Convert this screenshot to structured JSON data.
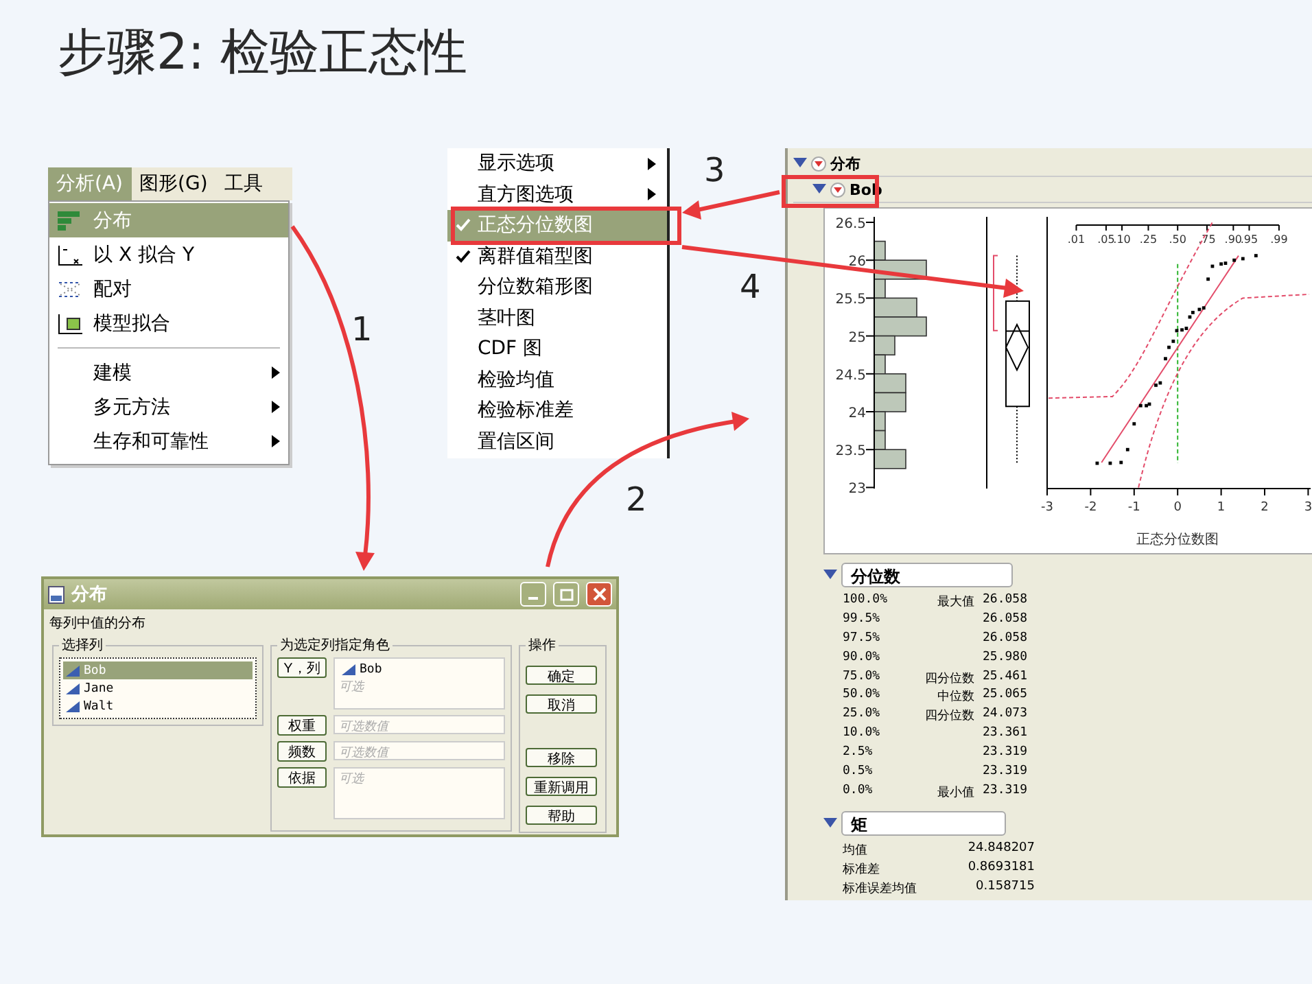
{
  "title": "步骤2: 检验正态性",
  "menu": {
    "bar": [
      {
        "label": "分析(A)",
        "selected": true
      },
      {
        "label": "图形(G)",
        "selected": false
      },
      {
        "label": "工具",
        "selected": false
      }
    ],
    "items": [
      {
        "kind": "command",
        "label": "分布",
        "selected": true
      },
      {
        "kind": "command",
        "label": "以 X 拟合 Y",
        "selected": false
      },
      {
        "kind": "command",
        "label": "配对",
        "selected": false
      },
      {
        "kind": "command",
        "label": "模型拟合",
        "selected": false
      },
      {
        "kind": "submenu",
        "label": "建模",
        "selected": false
      },
      {
        "kind": "submenu",
        "label": "多元方法",
        "selected": false
      },
      {
        "kind": "submenu",
        "label": "生存和可靠性",
        "selected": false
      }
    ]
  },
  "options_menu": {
    "items": [
      {
        "kind": "submenu",
        "label": "显示选项",
        "checked": false,
        "selected": false
      },
      {
        "kind": "submenu",
        "label": "直方图选项",
        "checked": false,
        "selected": false
      },
      {
        "kind": "command",
        "label": "正态分位数图",
        "checked": true,
        "selected": true
      },
      {
        "kind": "command",
        "label": "离群值箱型图",
        "checked": true,
        "selected": false
      },
      {
        "kind": "command",
        "label": "分位数箱形图",
        "checked": false,
        "selected": false
      },
      {
        "kind": "command",
        "label": "茎叶图",
        "checked": false,
        "selected": false
      },
      {
        "kind": "command",
        "label": "CDF 图",
        "checked": false,
        "selected": false
      },
      {
        "kind": "command",
        "label": "检验均值",
        "checked": false,
        "selected": false
      },
      {
        "kind": "command",
        "label": "检验标准差",
        "checked": false,
        "selected": false
      },
      {
        "kind": "command",
        "label": "置信区间",
        "checked": false,
        "selected": false
      }
    ]
  },
  "dialog": {
    "title": "分布",
    "subtitle": "每列中值的分布",
    "columns": {
      "title": "选择列",
      "items": [
        {
          "name": "Bob",
          "selected": true
        },
        {
          "name": "Jane",
          "selected": false
        },
        {
          "name": "Walt",
          "selected": false
        }
      ]
    },
    "roles": {
      "title": "为选定列指定角色",
      "rows": [
        {
          "button": "Y，列",
          "kind": "list",
          "items": [
            "Bob"
          ],
          "placeholder": "可选"
        },
        {
          "button": "权重",
          "kind": "single",
          "placeholder": "可选数值"
        },
        {
          "button": "频数",
          "kind": "single",
          "placeholder": "可选数值"
        },
        {
          "button": "依据",
          "kind": "list",
          "placeholder": "可选"
        }
      ]
    },
    "actions": {
      "title": "操作",
      "buttons": [
        "确定",
        "取消",
        "移除",
        "重新调用",
        "帮助"
      ]
    }
  },
  "report": {
    "title": "分布",
    "column": "Bob",
    "plot": {
      "y_ticks": [
        "26.5",
        "26",
        "25.5",
        "25",
        "24.5",
        "24",
        "23.5",
        "23"
      ],
      "x_ticks": [
        "-3",
        "-2",
        "-1",
        "0",
        "1",
        "2",
        "3"
      ],
      "prob_ticks": [
        ".01",
        ".05",
        ".10",
        ".25",
        ".50",
        ".75",
        ".90",
        ".95",
        ".99"
      ],
      "x_title": "正态分位数图"
    },
    "quantiles": {
      "title": "分位数",
      "rows": [
        {
          "percent": "100.0%",
          "label": "最大值",
          "value": "26.058"
        },
        {
          "percent": "99.5%",
          "value": "26.058"
        },
        {
          "percent": "97.5%",
          "value": "26.058"
        },
        {
          "percent": "90.0%",
          "value": "25.980"
        },
        {
          "percent": "75.0%",
          "label": "四分位数",
          "value": "25.461"
        },
        {
          "percent": "50.0%",
          "label": "中位数",
          "value": "25.065"
        },
        {
          "percent": "25.0%",
          "label": "四分位数",
          "value": "24.073"
        },
        {
          "percent": "10.0%",
          "value": "23.361"
        },
        {
          "percent": "2.5%",
          "value": "23.319"
        },
        {
          "percent": "0.5%",
          "value": "23.319"
        },
        {
          "percent": "0.0%",
          "label": "最小值",
          "value": "23.319"
        }
      ]
    },
    "moments": {
      "title": "矩",
      "rows": [
        {
          "label": "均值",
          "value": "24.848207"
        },
        {
          "label": "标准差",
          "value": "0.8693181"
        },
        {
          "label": "标准误差均值",
          "value": "0.158715"
        }
      ]
    }
  },
  "callouts": [
    "1",
    "2",
    "3",
    "4"
  ]
}
